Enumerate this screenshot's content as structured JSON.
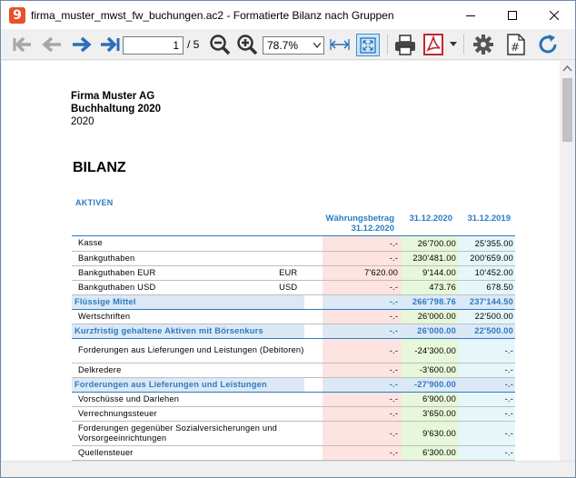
{
  "window": {
    "title": "firma_muster_mwst_fw_buchungen.ac2 - Formatierte Bilanz nach Gruppen",
    "app_icon_glyph": "9"
  },
  "toolbar": {
    "page_current": "1",
    "page_total": "/ 5",
    "zoom": "78.7%"
  },
  "report": {
    "company": "Firma Muster AG",
    "subtitle": "Buchhaltung 2020",
    "year": "2020",
    "heading": "BILANZ",
    "section": "AKTIVEN",
    "columns": {
      "fx_line1": "Währungsbetrag",
      "fx_line2": "31.12.2020",
      "current": "31.12.2020",
      "previous": "31.12.2019"
    },
    "rows": [
      {
        "label": "Kasse",
        "currency": "",
        "fx": "-.-",
        "cur": "26'700.00",
        "prev": "25'355.00",
        "type": "row"
      },
      {
        "label": "Bankguthaben",
        "currency": "",
        "fx": "-.-",
        "cur": "230'481.00",
        "prev": "200'659.00",
        "type": "row"
      },
      {
        "label": "Bankguthaben EUR",
        "currency": "EUR",
        "fx": "7'620.00",
        "cur": "9'144.00",
        "prev": "10'452.00",
        "type": "row"
      },
      {
        "label": "Bankguthaben USD",
        "currency": "USD",
        "fx": "-.-",
        "cur": "473.76",
        "prev": "678.50",
        "type": "row"
      },
      {
        "label": "Flüssige Mittel",
        "currency": "",
        "fx": "-.-",
        "cur": "266'798.76",
        "prev": "237'144.50",
        "type": "sum"
      },
      {
        "label": "Wertschriften",
        "currency": "",
        "fx": "-.-",
        "cur": "26'000.00",
        "prev": "22'500.00",
        "type": "row"
      },
      {
        "label": "Kurzfristig gehaltene Aktiven mit Börsenkurs",
        "currency": "",
        "fx": "-.-",
        "cur": "26'000.00",
        "prev": "22'500.00",
        "type": "sum"
      },
      {
        "label": "Forderungen aus Lieferungen und Leistungen (Debitoren)",
        "currency": "",
        "fx": "-.-",
        "cur": "-24'300.00",
        "prev": "-.-",
        "type": "two"
      },
      {
        "label": "Delkredere",
        "currency": "",
        "fx": "-.-",
        "cur": "-3'600.00",
        "prev": "-.-",
        "type": "row"
      },
      {
        "label": "Forderungen aus Lieferungen und Leistungen",
        "currency": "",
        "fx": "-.-",
        "cur": "-27'900.00",
        "prev": "-.-",
        "type": "sum"
      },
      {
        "label": "Vorschüsse und Darlehen",
        "currency": "",
        "fx": "-.-",
        "cur": "6'900.00",
        "prev": "-.-",
        "type": "row"
      },
      {
        "label": "Verrechnungssteuer",
        "currency": "",
        "fx": "-.-",
        "cur": "3'650.00",
        "prev": "-.-",
        "type": "row"
      },
      {
        "label": "Forderungen gegenüber Sozialversicherungen und Vorsorgeeinrichtungen",
        "currency": "",
        "fx": "-.-",
        "cur": "9'630.00",
        "prev": "-.-",
        "type": "two"
      },
      {
        "label": "Quellensteuer",
        "currency": "",
        "fx": "-.-",
        "cur": "6'300.00",
        "prev": "-.-",
        "type": "row"
      }
    ]
  }
}
